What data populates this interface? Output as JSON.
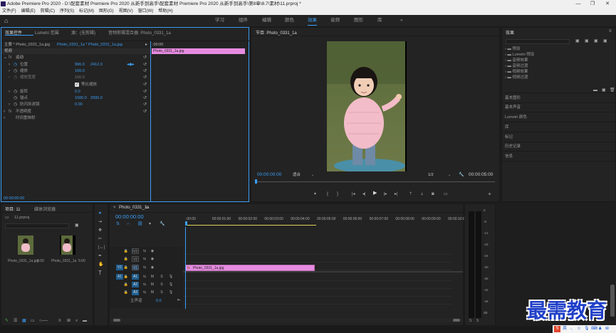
{
  "window": {
    "title": "Adobe Premiere Pro 2020 - D:\\配套素材 Premiere Pro 2020 从新手到高手\\配套素材 Premiere Pro 2020 从新手到高手\\第8章\\8.7\\素材\\11.prproj *"
  },
  "menu": [
    "文件(F)",
    "编辑(E)",
    "剪辑(C)",
    "序列(S)",
    "标记(M)",
    "图形(G)",
    "视图(V)",
    "窗口(W)",
    "帮助(H)"
  ],
  "workspaces": [
    "学习",
    "组件",
    "编辑",
    "颜色",
    "效果",
    "音频",
    "图形",
    "库"
  ],
  "effect_controls": {
    "tabs": [
      "效果控件",
      "Lumetri 范围",
      "源：(无剪辑)",
      "音频剪辑混合器: Photo_0331_1a"
    ],
    "source_label": "主要 * Photo_0331_1a.jpg",
    "seq_label": "Photo_0331_1a * Photo_0331_1a.jpg",
    "clip_label": "Photo_0331_1a.jpg",
    "timecode_ruler": ":00:00",
    "section_video": "视频",
    "motion": "运动",
    "position_label": "位置",
    "position_x": "996.0",
    "position_y": "2412.0",
    "scale_label": "缩放",
    "scale_value": "100.0",
    "scale_width_label": "缩放宽度",
    "scale_width_value": "100.0",
    "uniform_scale_label": "等比缩放",
    "rotation_label": "旋转",
    "rotation_value": "0.0",
    "anchor_label": "锚点",
    "anchor_x": "1500.0",
    "anchor_y": "2000.0",
    "antiflicker_label": "防闪烁滤镜",
    "antiflicker_value": "0.00",
    "opacity_label": "不透明度",
    "time_remap_label": "时间重映射",
    "bottom_timecode": "00:00:00:00"
  },
  "program": {
    "title": "节目: Photo_0331_1a",
    "timecode": "00:00:00:00",
    "fit": "适合",
    "resolution": "1/2",
    "duration": "00:00:05:00"
  },
  "effects_panel": {
    "title": "效果",
    "folders": [
      "预设",
      "Lumetri 预设",
      "音频效果",
      "音频过渡",
      "视频效果",
      "视频过渡"
    ],
    "sections": [
      "基本图形",
      "基本声音",
      "Lumetri 颜色",
      "库",
      "标记",
      "历史记录",
      "信息"
    ]
  },
  "project": {
    "tabs": [
      "项目: 11",
      "媒体浏览器"
    ],
    "file": "11.prproj",
    "items": [
      {
        "name": "Photo_0331_1a.jpg",
        "duration": "5:00"
      },
      {
        "name": "Photo_0331_1a",
        "duration": "5:00"
      }
    ]
  },
  "timeline": {
    "tab": "Photo_0331_1a",
    "timecode": "00:00:00:00",
    "ruler": [
      ":00:00",
      "00:00:01:00",
      "00:00:02:00",
      "00:00:03:00",
      "00:00:04:00",
      "00:00:05:00",
      "00:00:06:00",
      "00:00:07:00",
      "00:00:08:00",
      "00:00:09:00",
      "00:00:10:00"
    ],
    "video_tracks": [
      "V3",
      "V2",
      "V1"
    ],
    "audio_tracks": [
      "A1",
      "A2",
      "A3"
    ],
    "master": "主声道",
    "master_value": "0.0",
    "clip": "Photo_0331_1a.jpg"
  },
  "meter": {
    "scale": [
      "0",
      "-6",
      "-12",
      "-18",
      "-24",
      "-30",
      "-36",
      "-42",
      "-48",
      "dB"
    ],
    "footer": [
      "S",
      "S"
    ]
  },
  "watermark": {
    "text": "最需教育"
  },
  "colors": {
    "accent": "#3b9ef5",
    "clip": "#e68be0",
    "bg": "#232323"
  }
}
